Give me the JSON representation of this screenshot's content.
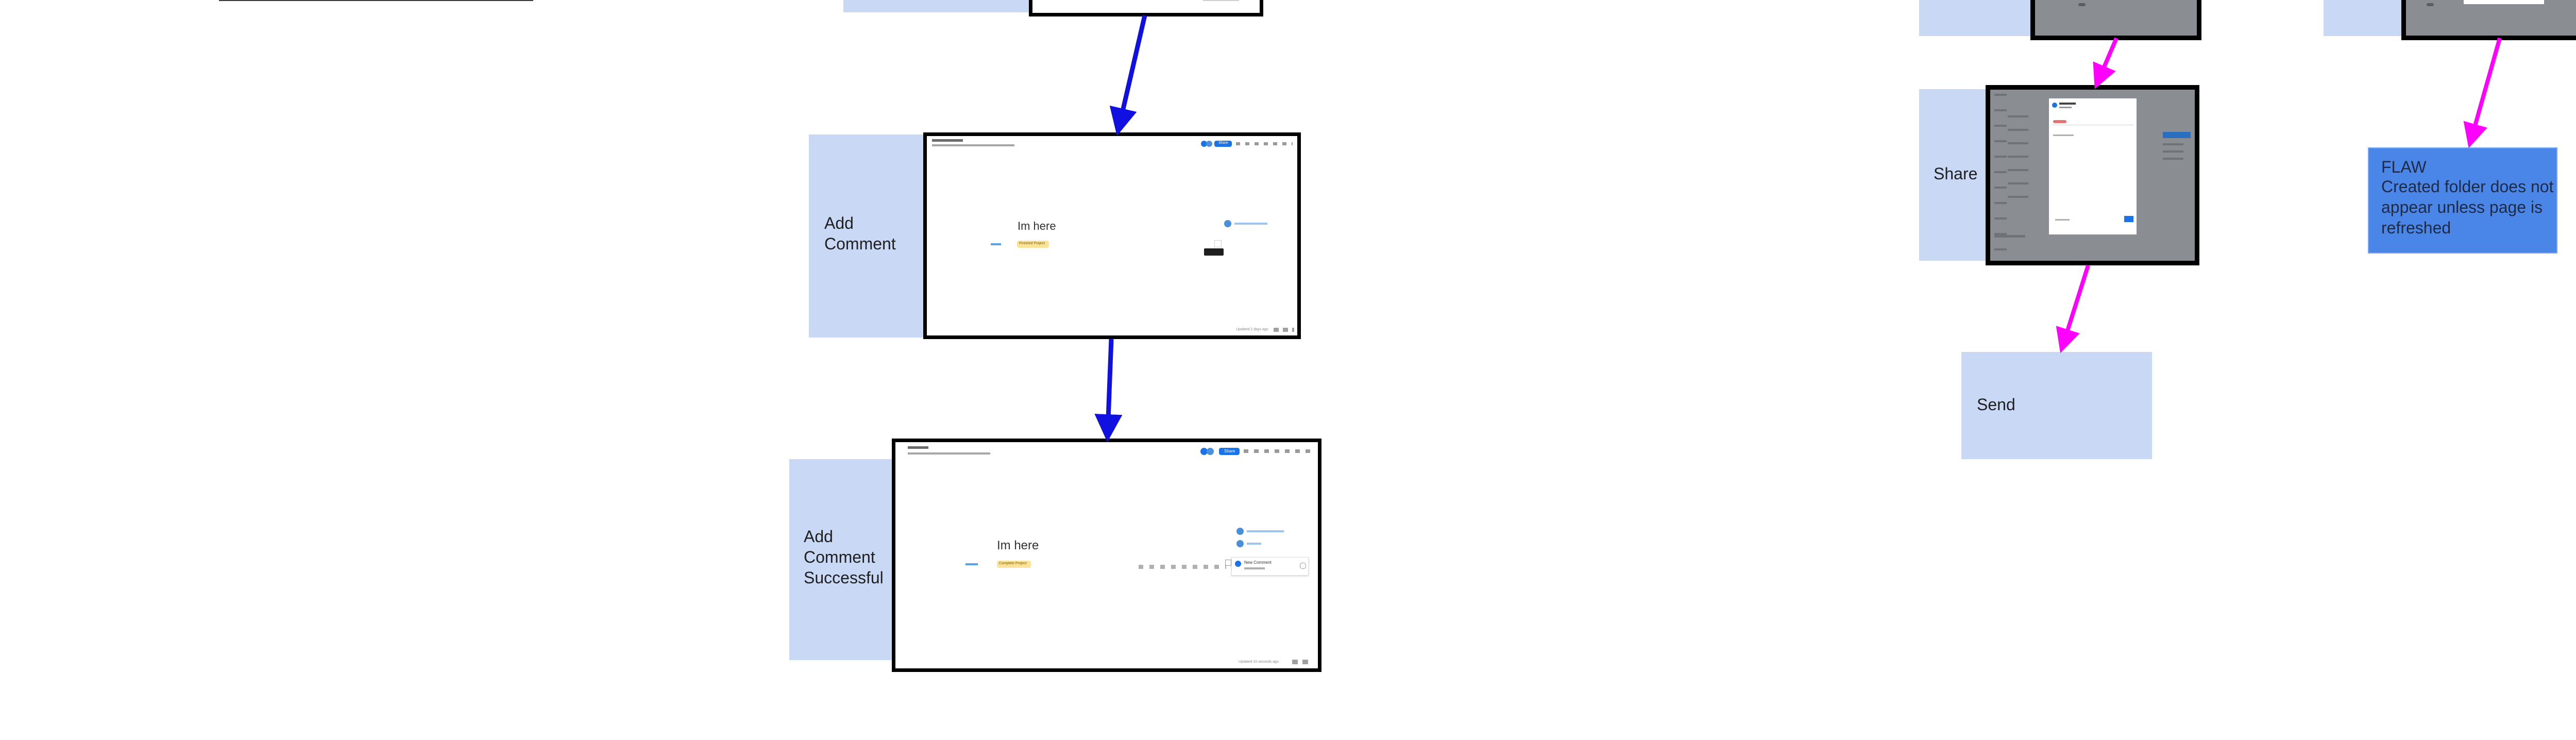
{
  "colors": {
    "flow_arrow": "#1010e0",
    "share_arrow": "#ff00ff",
    "label_bg": "#c9d9f5",
    "flaw_bg": "#4a86e8"
  },
  "steps": {
    "add_comment": "Add\nComment",
    "add_comment_successful": "Add\nComment\nSuccessful",
    "share": "Share",
    "send": "Send"
  },
  "flaw": {
    "title": "FLAW",
    "text": "Created folder does not appear unless page is refreshed"
  },
  "shot_add_comment": {
    "heading": "Im here",
    "tag": "Finished Project",
    "share_button": "Share",
    "footer": "Updated 2 days ago"
  },
  "shot_add_comment_successful": {
    "heading": "Im here",
    "tag": "Complete Project",
    "share_button": "Share",
    "comment_title": "New Comment",
    "footer": "Updated 10 seconds ago"
  }
}
